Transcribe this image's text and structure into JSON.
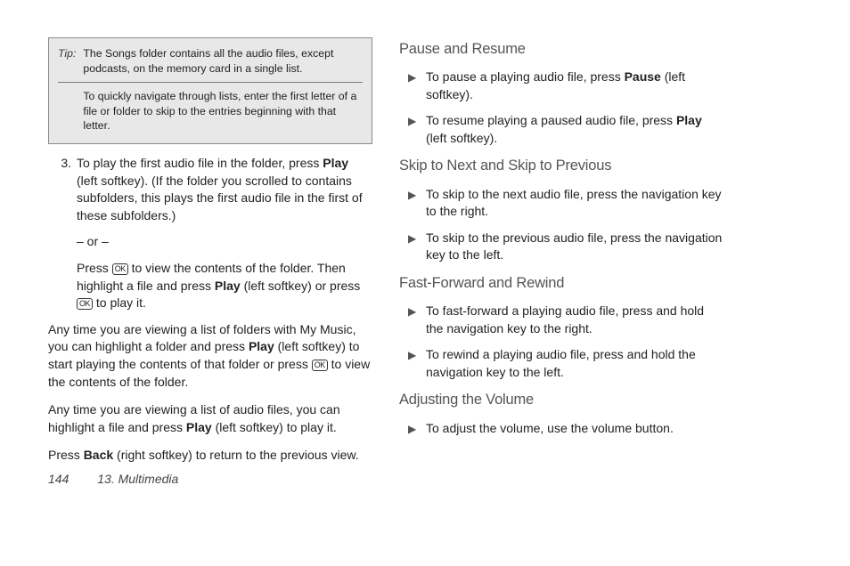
{
  "tip": {
    "label": "Tip:",
    "p1": "The Songs folder contains all the audio files, except podcasts, on the memory card in a single list.",
    "p2": "To quickly navigate through lists, enter the first letter of a file or folder to skip to the entries beginning with that letter."
  },
  "left": {
    "step3": {
      "num": "3.",
      "a": "To play the first audio file in the folder, press ",
      "play": "Play",
      "b": " (left softkey). (If the folder you scrolled to contains subfolders, this plays the first audio file in the first of these subfolders.)"
    },
    "or": "– or –",
    "press_ok": {
      "a": "Press ",
      "ok": "OK",
      "b": " to view the contents of the folder. Then highlight a file and press ",
      "play": "Play",
      "c": " (left softkey) or press ",
      "ok2": "OK",
      "d": " to play it."
    },
    "para1": {
      "a": "Any time you are viewing a list of folders with My Music, you can highlight a folder and press ",
      "play": "Play",
      "b": " (left softkey) to start playing the contents of that folder or press ",
      "ok": "OK",
      "c": " to view the contents of the folder."
    },
    "para2": {
      "a": "Any time you are viewing a list of audio files, you can highlight a file and press ",
      "play": "Play",
      "b": " (left softkey) to play it."
    },
    "para3": {
      "a": "Press ",
      "back": "Back",
      "b": " (right softkey) to return to the previous view."
    }
  },
  "right": {
    "pause_h": "Pause and Resume",
    "pause1": {
      "a": "To pause a playing audio file, press ",
      "pause": "Pause",
      "b": " (left softkey)."
    },
    "pause2": {
      "a": "To resume playing a paused audio file, press ",
      "play": "Play",
      "b": " (left softkey)."
    },
    "skip_h": "Skip to Next and Skip to Previous",
    "skip1": "To skip to the next audio file, press the navigation key to the right.",
    "skip2": "To skip to the previous audio file, press the navigation key to the left.",
    "ff_h": "Fast-Forward and Rewind",
    "ff1": "To fast-forward a playing audio file, press and hold the navigation key to the right.",
    "ff2": "To rewind a playing audio file, press and hold the navigation key to the left.",
    "vol_h": "Adjusting the Volume",
    "vol1": "To adjust the volume, use the volume button."
  },
  "footer": {
    "page": "144",
    "section": "13. Multimedia"
  }
}
